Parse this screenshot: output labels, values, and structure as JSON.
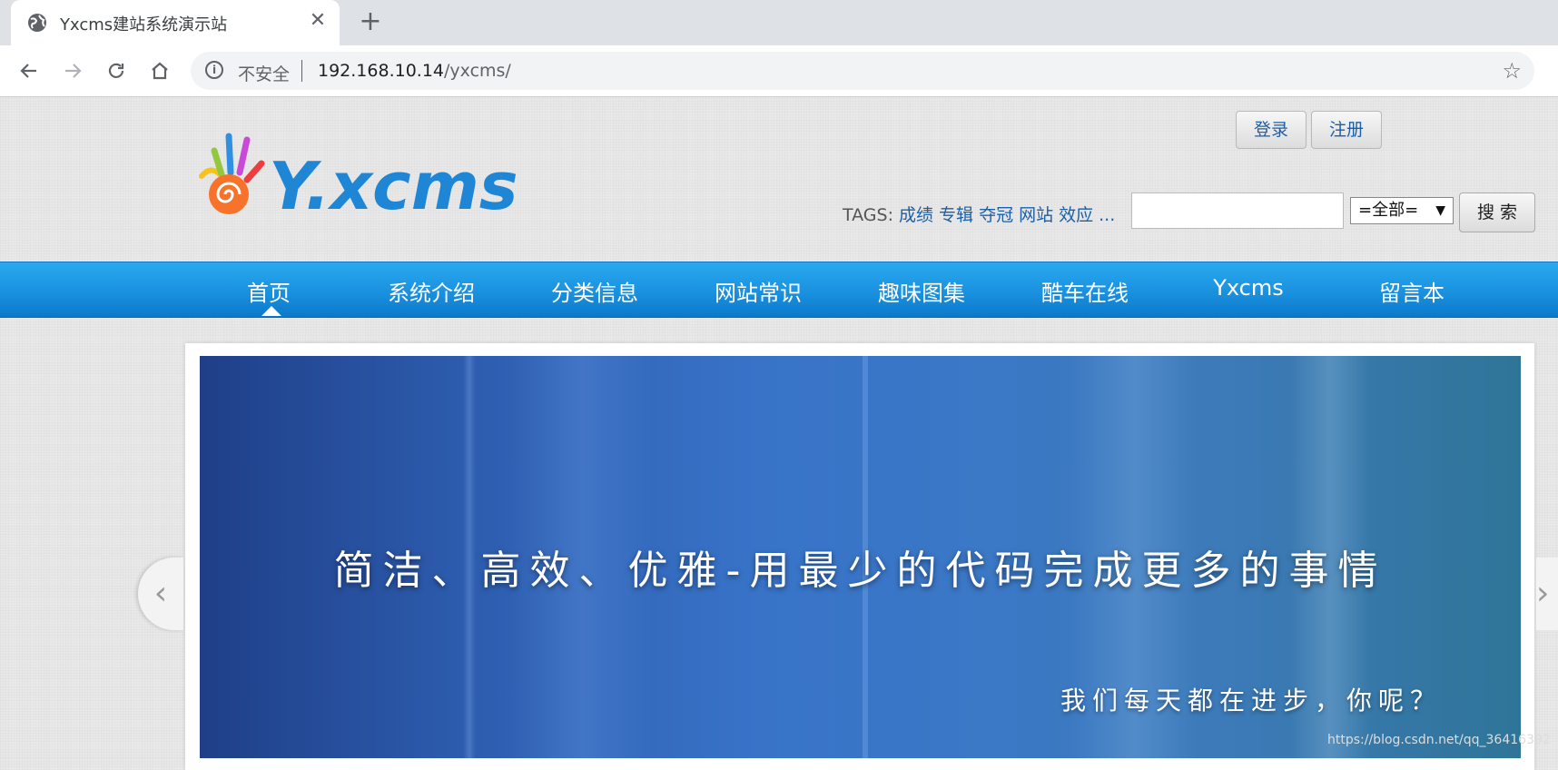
{
  "browser": {
    "tab_title": "Yxcms建站系统演示站",
    "tab_close": "✕",
    "new_tab": "+",
    "security_label": "不安全",
    "url_host": "192.168.10.14",
    "url_path": "/yxcms/"
  },
  "header": {
    "logo_text": "Y.xcms",
    "login_label": "登录",
    "register_label": "注册",
    "tags_prefix": "TAGS:",
    "tags": [
      "成绩",
      "专辑",
      "夺冠",
      "网站",
      "效应",
      "..."
    ],
    "search_value": "",
    "search_scope": "=全部=",
    "search_button": "搜 索"
  },
  "nav": {
    "items": [
      "首页",
      "系统介绍",
      "分类信息",
      "网站常识",
      "趣味图集",
      "酷车在线",
      "Yxcms",
      "留言本"
    ],
    "active_index": 0
  },
  "banner": {
    "headline": "简洁、高效、优雅-用最少的代码完成更多的事情",
    "subline": "我们每天都在进步，你呢？",
    "prev": "‹",
    "next": "›"
  },
  "watermark": "https://blog.csdn.net/qq_36416392",
  "colors": {
    "nav_top": "#2aa9ef",
    "nav_bottom": "#0b79c9",
    "link": "#1a5fa8"
  }
}
